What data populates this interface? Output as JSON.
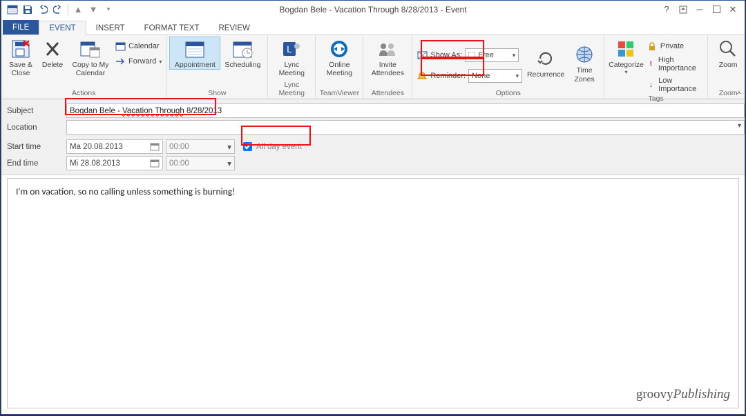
{
  "window_title": "Bogdan Bele - Vacation Through 8/28/2013 - Event",
  "tabs": {
    "file": "FILE",
    "event": "EVENT",
    "insert": "INSERT",
    "format_text": "FORMAT TEXT",
    "review": "REVIEW"
  },
  "ribbon": {
    "actions": {
      "save_close": "Save & Close",
      "delete": "Delete",
      "copy_to_my_cal": "Copy to My Calendar",
      "calendar": "Calendar",
      "forward": "Forward",
      "label": "Actions"
    },
    "show": {
      "appointment": "Appointment",
      "scheduling": "Scheduling",
      "label": "Show"
    },
    "lync": {
      "btn": "Lync Meeting",
      "label": "Lync Meeting"
    },
    "tv": {
      "btn": "Online Meeting",
      "label": "TeamViewer"
    },
    "attendees": {
      "btn": "Invite Attendees",
      "label": "Attendees"
    },
    "options": {
      "show_as_label": "Show As:",
      "show_as_value": "Free",
      "reminder_label": "Reminder:",
      "reminder_value": "None",
      "recurrence": "Recurrence",
      "time_zones": "Time Zones",
      "label": "Options"
    },
    "tags": {
      "categorize": "Categorize",
      "private": "Private",
      "high": "High Importance",
      "low": "Low Importance",
      "label": "Tags"
    },
    "zoom": {
      "btn": "Zoom",
      "label": "Zoom"
    }
  },
  "form": {
    "subject_label": "Subject",
    "subject_prefix": "Bogdan Bele - ",
    "subject_mid": "Vacation Through",
    "subject_suffix": " 8/28/2013",
    "location_label": "Location",
    "location_value": "",
    "start_label": "Start time",
    "start_date": "Ma 20.08.2013",
    "start_time": "00:00",
    "end_label": "End time",
    "end_date": "Mi 28.08.2013",
    "end_time": "00:00",
    "all_day_label": "All day event"
  },
  "body_text": "I'm on vacation, so no calling unless something is burning!",
  "watermark": "groovyPublishing"
}
